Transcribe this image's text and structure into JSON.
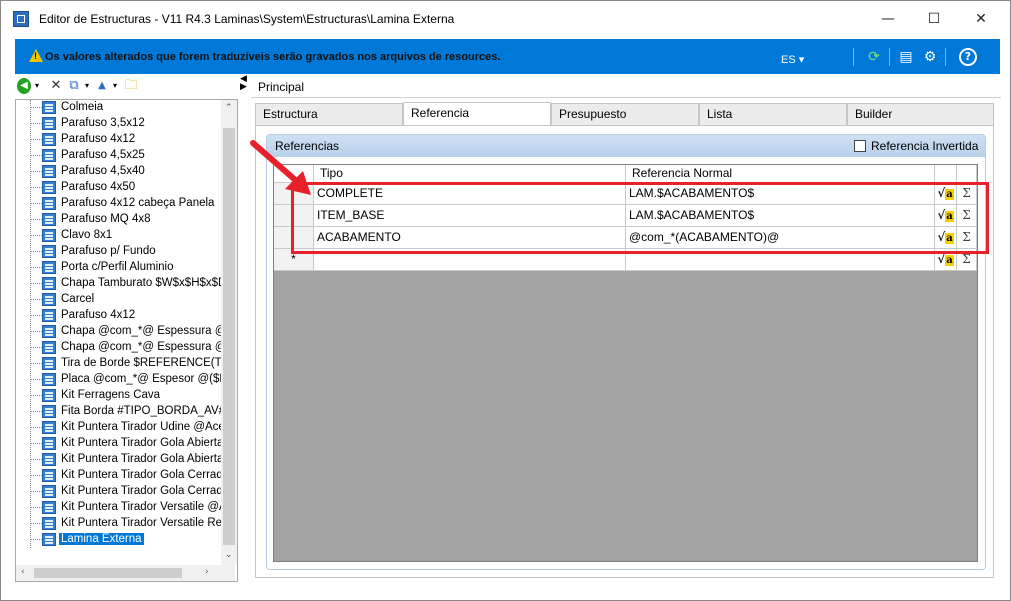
{
  "window": {
    "title": "Editor de Estructuras - V11 R4.3 Laminas\\System\\Estructuras\\Lamina Externa",
    "controls": {
      "minimize": "—",
      "maximize": "☐",
      "close": "✕"
    }
  },
  "infobar": {
    "message": "Os valores alterados que forem traduzíveis serão gravados nos arquivos de resources.",
    "language": "ES ▾",
    "icons": [
      "refresh-icon",
      "panel-icon",
      "settings-icon",
      "help-icon"
    ],
    "accent_color": "#0078d7"
  },
  "tree": {
    "items": [
      {
        "label": "Colmeia"
      },
      {
        "label": "Parafuso 3,5x12"
      },
      {
        "label": "Parafuso 4x12"
      },
      {
        "label": "Parafuso 4,5x25"
      },
      {
        "label": "Parafuso 4,5x40"
      },
      {
        "label": "Parafuso 4x50"
      },
      {
        "label": "Parafuso 4x12  cabeça Panela"
      },
      {
        "label": "Parafuso MQ 4x8"
      },
      {
        "label": "Clavo 8x1"
      },
      {
        "label": "Parafuso p/ Fundo"
      },
      {
        "label": "Porta c/Perfil Aluminio"
      },
      {
        "label": "Chapa Tamburato $W$x$H$x$D"
      },
      {
        "label": "Carcel"
      },
      {
        "label": "Parafuso 4x12"
      },
      {
        "label": "Chapa @com_*@ Espessura @"
      },
      {
        "label": "Chapa @com_*@  Espessura @"
      },
      {
        "label": "Tira de Borde $REFERENCE(T"
      },
      {
        "label": "Placa @com_*@ Espesor @($H"
      },
      {
        "label": "Kit Ferragens Cava"
      },
      {
        "label": "Fita Borda #TIPO_BORDA_AV#"
      },
      {
        "label": "Kit Puntera Tirador Udine @Ace"
      },
      {
        "label": "Kit Puntera Tirador Gola Abierta"
      },
      {
        "label": "Kit Puntera Tirador Gola Abierta"
      },
      {
        "label": "Kit Puntera Tirador Gola Cerrad"
      },
      {
        "label": "Kit Puntera Tirador Gola Cerrad"
      },
      {
        "label": "Kit Puntera Tirador Versatile @A"
      },
      {
        "label": "Kit Puntera Tirador Versatile Re"
      },
      {
        "label": "Lamina Externa",
        "selected": true
      }
    ]
  },
  "panel": {
    "title": "Principal",
    "tabs": [
      "Estructura",
      "Referencia",
      "Presupuesto",
      "Lista",
      "Builder"
    ],
    "active_tab": "Referencia",
    "group_title": "Referencias",
    "checkbox_label": "Referencia Invertida",
    "checkbox_checked": false
  },
  "grid": {
    "columns": [
      "Tipo",
      "Referencia Normal"
    ],
    "rows": [
      {
        "tipo": "COMPLETE",
        "referencia": "LAM.$ACABAMENTO$"
      },
      {
        "tipo": "ITEM_BASE",
        "referencia": "LAM.$ACABAMENTO$"
      },
      {
        "tipo": "ACABAMENTO",
        "referencia": "@com_*(ACABAMENTO)@"
      }
    ],
    "new_row_marker": "*",
    "fx_icon_text": "√a",
    "sigma_text": "Σ"
  },
  "annotation": {
    "highlight_color": "#e8202a"
  }
}
